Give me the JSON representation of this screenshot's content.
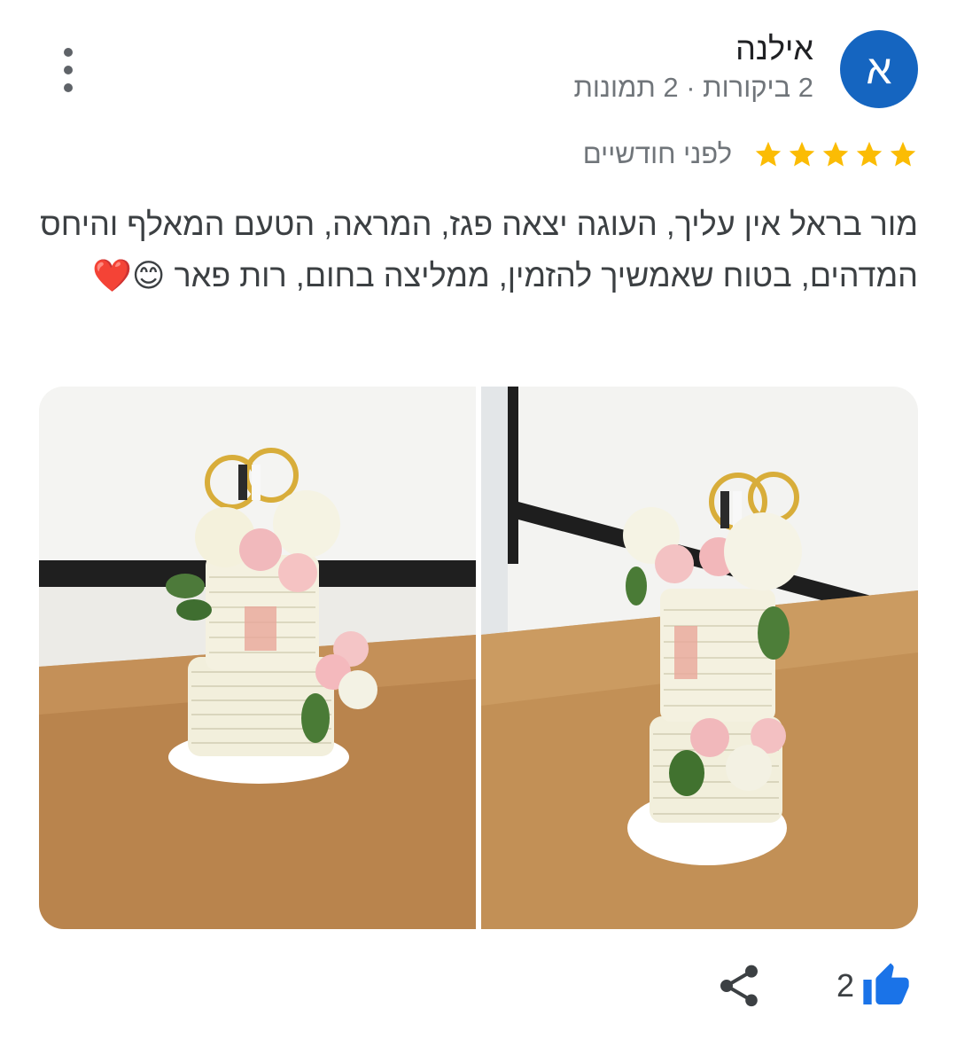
{
  "review": {
    "avatar_letter": "א",
    "reviewer_name": "אילנה",
    "reviewer_meta": "2 ביקורות · 2 תמונות",
    "rating": 5,
    "rating_max": 5,
    "time": "לפני חודשיים",
    "text": "מור בראל אין עליך, העוגה יצאה פגז, המראה, הטעם המאלף והיחס המדהים, בטוח שאמשיך להזמין, ממליצה בחום, רות פאר 😊❤️",
    "like_count": "2"
  },
  "photos": {
    "count": 2
  },
  "icons": {
    "more": "more-vert-icon",
    "star": "star-icon",
    "like": "thumb-up-icon",
    "share": "share-icon"
  },
  "colors": {
    "avatar_bg": "#1565c0",
    "star": "#fbbc04",
    "like": "#1a73e8",
    "secondary_text": "#70757a"
  }
}
